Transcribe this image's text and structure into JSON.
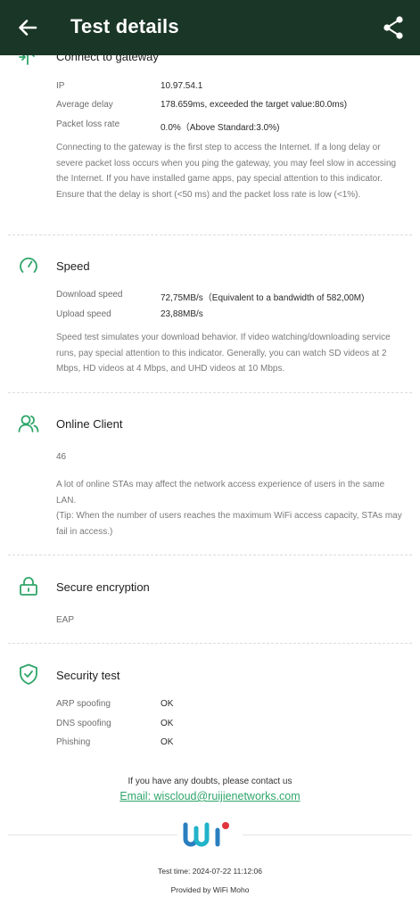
{
  "appbar": {
    "title": "Test details",
    "back_icon": "arrow-left-icon",
    "share_icon": "share-icon",
    "background": "#1a3626"
  },
  "gateway": {
    "title": "Connect to gateway",
    "icon": "gateway-connect-icon",
    "rows": [
      {
        "label": "IP",
        "value": "10.97.54.1"
      },
      {
        "label": "Average delay",
        "value": "178.659ms, exceeded the target value:80.0ms)"
      },
      {
        "label": "Packet loss rate",
        "value": "0.0%（Above Standard:3.0%)"
      }
    ],
    "description": "Connecting to the gateway is the first step to access the Internet. If a long delay or severe packet loss occurs when you ping the gateway, you may feel slow in accessing the Internet. If you have installed game apps, pay special attention to this indicator. Ensure that the delay is short (<50 ms) and the packet loss rate is low (<1%)."
  },
  "speed": {
    "title": "Speed",
    "icon": "speedometer-icon",
    "rows": [
      {
        "label": "Download speed",
        "value": "72,75MB/s（Equivalent to a bandwidth of 582,00M)"
      },
      {
        "label": "Upload speed",
        "value": "23,88MB/s"
      }
    ],
    "description": "Speed test simulates your download behavior. If video watching/downloading service runs, pay special attention to this indicator. Generally, you can watch SD videos at 2 Mbps, HD videos at 4 Mbps, and UHD videos at 10 Mbps."
  },
  "clients": {
    "title": "Online Client",
    "icon": "users-icon",
    "count": "46",
    "description": "A lot of online STAs may affect the network access experience of users in the same LAN.",
    "tip": "(Tip: When the number of users reaches the maximum WiFi access capacity, STAs may fail in access.)"
  },
  "encryption": {
    "title": "Secure encryption",
    "icon": "lock-icon",
    "value": "EAP"
  },
  "security": {
    "title": "Security test",
    "icon": "shield-check-icon",
    "rows": [
      {
        "label": "ARP spoofing",
        "value": "OK"
      },
      {
        "label": "DNS spoofing",
        "value": "OK"
      },
      {
        "label": "Phishing",
        "value": "OK"
      }
    ]
  },
  "footer": {
    "contact": "If you have any doubts, please contact us",
    "email": "Email: wiscloud@ruijienetworks.com",
    "test_time": "Test time: 2024-07-22 11:12:06",
    "provided_by": "Provided by WiFi Moho"
  },
  "colors": {
    "accent": "#2fa56a",
    "logo_blue": "#2a7fbf",
    "logo_teal": "#21b3c9",
    "logo_red": "#e2343c"
  }
}
